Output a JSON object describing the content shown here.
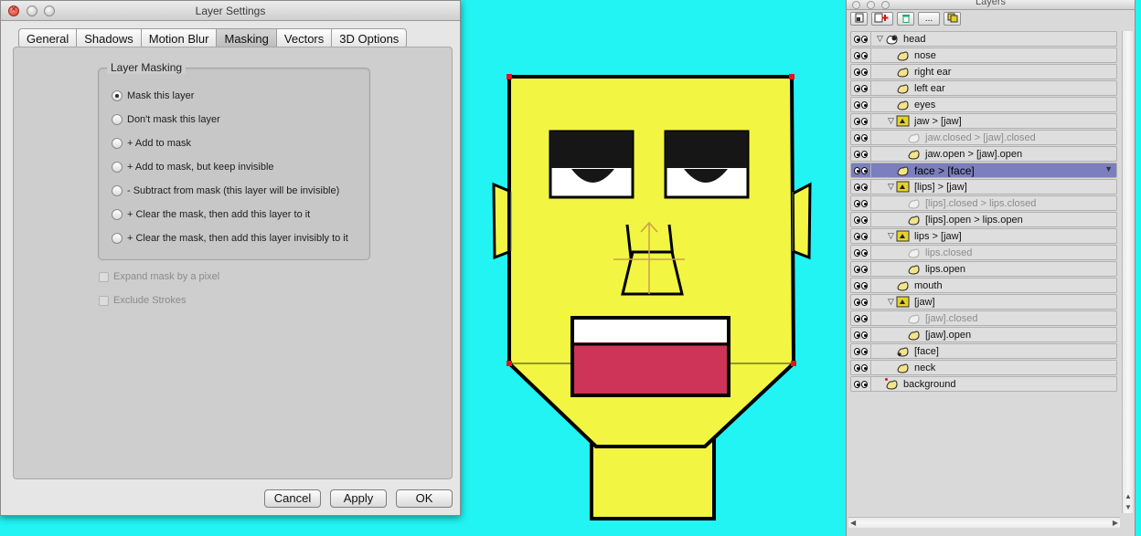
{
  "dialog": {
    "title": "Layer Settings",
    "tabs": [
      "General",
      "Shadows",
      "Motion Blur",
      "Masking",
      "Vectors",
      "3D Options"
    ],
    "active_tab": "Masking",
    "group_title": "Layer Masking",
    "options": [
      "Mask this layer",
      "Don't mask this layer",
      "+ Add to mask",
      "+ Add to mask, but keep invisible",
      "- Subtract from mask (this layer will be invisible)",
      "+ Clear the mask, then add this layer to it",
      "+ Clear the mask, then add this layer invisibly to it"
    ],
    "selected_option": "Mask this layer",
    "checkboxes": [
      "Expand mask by a pixel",
      "Exclude Strokes"
    ],
    "buttons": {
      "cancel": "Cancel",
      "apply": "Apply",
      "ok": "OK"
    }
  },
  "layers_panel": {
    "title": "Layers",
    "toolbar_icons": [
      "new-layer-icon",
      "new-group-icon",
      "trash-icon",
      "more-icon",
      "duplicate-icon"
    ],
    "more_label": "...",
    "rows": [
      {
        "name": "head",
        "dim": false,
        "selected": false
      },
      {
        "name": "nose",
        "dim": false,
        "selected": false
      },
      {
        "name": "right ear",
        "dim": false,
        "selected": false
      },
      {
        "name": "left ear",
        "dim": false,
        "selected": false
      },
      {
        "name": "eyes",
        "dim": false,
        "selected": false
      },
      {
        "name": "jaw > [jaw]",
        "dim": false,
        "selected": false
      },
      {
        "name": "jaw.closed > [jaw].closed",
        "dim": true,
        "selected": false
      },
      {
        "name": "jaw.open > [jaw].open",
        "dim": false,
        "selected": false
      },
      {
        "name": "face > [face]",
        "dim": false,
        "selected": true
      },
      {
        "name": "[lips] > [jaw]",
        "dim": false,
        "selected": false
      },
      {
        "name": "[lips].closed > lips.closed",
        "dim": true,
        "selected": false
      },
      {
        "name": "[lips].open > lips.open",
        "dim": false,
        "selected": false
      },
      {
        "name": "lips > [jaw]",
        "dim": false,
        "selected": false
      },
      {
        "name": "lips.closed",
        "dim": true,
        "selected": false
      },
      {
        "name": "lips.open",
        "dim": false,
        "selected": false
      },
      {
        "name": "mouth",
        "dim": false,
        "selected": false
      },
      {
        "name": "[jaw]",
        "dim": false,
        "selected": false
      },
      {
        "name": "[jaw].closed",
        "dim": true,
        "selected": false
      },
      {
        "name": "[jaw].open",
        "dim": false,
        "selected": false
      },
      {
        "name": "[face]",
        "dim": false,
        "selected": false
      },
      {
        "name": "neck",
        "dim": false,
        "selected": false
      },
      {
        "name": "background",
        "dim": false,
        "selected": false
      }
    ]
  },
  "colors": {
    "canvas_bg": "#22f3f3",
    "face_fill": "#f2f542",
    "mouth_red": "#cd3457",
    "selection_row": "#7b7fbd"
  }
}
